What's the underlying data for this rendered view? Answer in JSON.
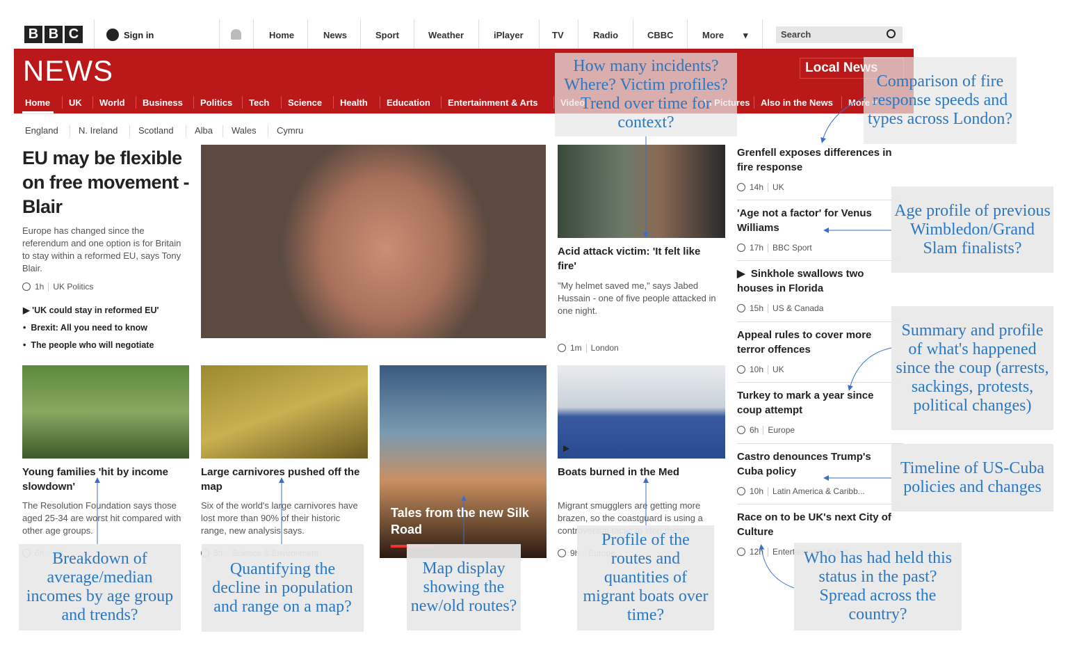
{
  "topbar": {
    "logo": "BBC",
    "logo_letters": [
      "B",
      "B",
      "C"
    ],
    "sign_in": "Sign in",
    "nav": [
      "Home",
      "News",
      "Sport",
      "Weather",
      "iPlayer",
      "TV",
      "Radio",
      "CBBC",
      "More"
    ],
    "more_arrow": "▾",
    "search_placeholder": "Search"
  },
  "news_header": {
    "logo": "NEWS",
    "local_news": "Local News",
    "nav": [
      "Home",
      "UK",
      "World",
      "Business",
      "Politics",
      "Tech",
      "Science",
      "Health",
      "Education",
      "Entertainment & Arts",
      "Video",
      "In Pictures",
      "Also in the News",
      "More ▾"
    ],
    "subnav": [
      "England",
      "N. Ireland",
      "Scotland",
      "Alba",
      "Wales",
      "Cymru"
    ],
    "accent": "#bb1919"
  },
  "lead": {
    "title": "EU may be flexible on free movement - Blair",
    "summary": "Europe has changed since the referendum and one option is for Britain to stay within a reformed EU, says Tony Blair.",
    "time": "1h",
    "section": "UK Politics",
    "links": [
      "'UK could stay in reformed EU'",
      "Brexit: All you need to know",
      "The people who will negotiate"
    ]
  },
  "acid": {
    "title": "Acid attack victim: 'It felt like fire'",
    "summary": "\"My helmet saved me,\" says Jabed Hussain - one of five people attacked in one night.",
    "time": "1m",
    "section": "London"
  },
  "right": [
    {
      "title": "Grenfell exposes differences in fire response",
      "time": "14h",
      "section": "UK"
    },
    {
      "title": "'Age not a factor' for Venus Williams",
      "time": "17h",
      "section": "BBC Sport"
    },
    {
      "title": "Sinkhole swallows two houses in Florida",
      "time": "15h",
      "section": "US & Canada"
    },
    {
      "title": "Appeal rules to cover more terror offences",
      "time": "10h",
      "section": "UK"
    },
    {
      "title": "Turkey to mark a year since coup attempt",
      "time": "6h",
      "section": "Europe"
    },
    {
      "title": "Castro denounces Trump's Cuba policy",
      "time": "10h",
      "section": "Latin America & Caribb..."
    },
    {
      "title": "Race on to be UK's next City of Culture",
      "time": "12h",
      "section": "Entertainment & Arts"
    }
  ],
  "row2": [
    {
      "title": "Young families 'hit by income slowdown'",
      "summary": "The Resolution Foundation says those aged 25-34 are worst hit compared with other age groups.",
      "time": "6h",
      "section": "UK"
    },
    {
      "title": "Large carnivores pushed off the map",
      "summary": "Six of the world's large carnivores have lost more than 90% of their historic range, new analysis says.",
      "time": "8h",
      "section": "Science & Environment"
    },
    {
      "title": "Tales from the new Silk Road"
    },
    {
      "title": "Boats burned in the Med",
      "summary": "Migrant smugglers are getting more brazen, so the coastguard is using a controversial tactic to stop them.",
      "time": "9h",
      "section": "Europe"
    }
  ],
  "annotations": [
    "How many incidents? Where? Victim profiles? Trend over time for context?",
    "Comparison of fire response speeds and types across London?",
    "Age profile of previous Wimbledon/Grand Slam finalists?",
    "Summary and profile of what's happened since the coup (arrests, sackings, protests, political changes)",
    "Timeline of US-Cuba policies and changes",
    "Breakdown of average/median incomes by age group and trends?",
    "Quantifying the decline in population and range on a map?",
    "Map display showing the new/old routes?",
    "Profile of the routes and quantities of migrant boats over time?",
    "Who has had held this status in the past? Spread across the country?"
  ],
  "annotation_color": "#2a77c2"
}
